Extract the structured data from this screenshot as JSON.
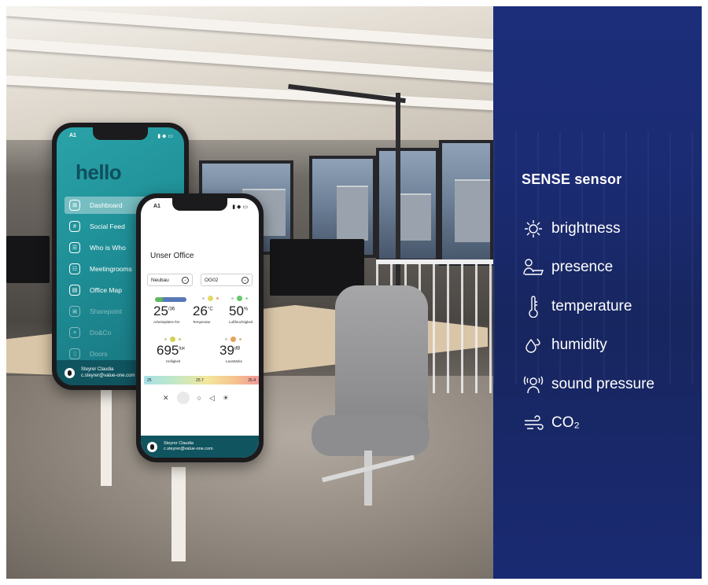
{
  "phone1": {
    "time": "A1",
    "status_icons": "▮ ◆ ▭",
    "greeting": "hello",
    "menu": [
      {
        "label": "Dashboard",
        "icon": "dashboard-icon",
        "glyph": "⊞",
        "active": true
      },
      {
        "label": "Social Feed",
        "icon": "hashtag-icon",
        "glyph": "#",
        "active": false
      },
      {
        "label": "Who is Who",
        "icon": "people-icon",
        "glyph": "☰",
        "active": false
      },
      {
        "label": "Meetingrooms",
        "icon": "meeting-icon",
        "glyph": "☷",
        "active": false
      },
      {
        "label": "Office Map",
        "icon": "map-icon",
        "glyph": "▤",
        "active": false
      },
      {
        "label": "Sharepoint",
        "icon": "sharepoint-icon",
        "glyph": "▣",
        "active": false
      },
      {
        "label": "Do&Co",
        "icon": "doco-icon",
        "glyph": "✶",
        "active": false
      },
      {
        "label": "Doors",
        "icon": "doors-icon",
        "glyph": "▯",
        "active": false
      }
    ],
    "user_name": "Steyrer Claudia",
    "user_email": "c.steyrer@value-one.com"
  },
  "phone2": {
    "time": "A1",
    "status_icons": "▮ ◆ ▭",
    "title": "Unser Office",
    "building": "Neubau",
    "floor": "OG02",
    "workplaces": {
      "value": "25",
      "unit": "/36",
      "label": "Arbeitsplätze frei"
    },
    "temperature": {
      "value": "26",
      "unit": "°C",
      "label": "Temperatur"
    },
    "humidity": {
      "value": "50",
      "unit": "%",
      "label": "Luftfeuchtigkeit"
    },
    "brightness": {
      "value": "695",
      "unit": "lux",
      "label": "Helligkeit"
    },
    "loudness": {
      "value": "39",
      "unit": "dB",
      "label": "Lautstärke"
    },
    "scale": {
      "min": "25",
      "mid": "25.7",
      "max": "26.4"
    },
    "tools": [
      "✕",
      "●",
      "○",
      "◁",
      "☀"
    ],
    "user_name": "Steyrer Claudia",
    "user_email": "c.steyrer@value-one.com"
  },
  "panel": {
    "title": "SENSE sensor",
    "items": [
      {
        "label": "brightness",
        "icon": "sun-icon"
      },
      {
        "label": "presence",
        "icon": "presence-icon"
      },
      {
        "label": "temperature",
        "icon": "thermometer-icon"
      },
      {
        "label": "humidity",
        "icon": "droplet-icon"
      },
      {
        "label": "sound pressure",
        "icon": "sound-icon"
      },
      {
        "label": "CO₂",
        "icon": "wind-icon"
      }
    ],
    "bg_color": "#1b2b73"
  }
}
